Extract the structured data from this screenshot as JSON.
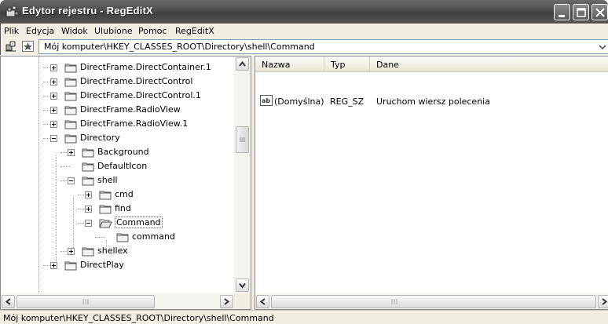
{
  "window": {
    "title": "Edytor rejestru - RegEditX"
  },
  "menu": [
    "Plik",
    "Edycja",
    "Widok",
    "Ulubione",
    "Pomoc",
    "RegEditX"
  ],
  "address": {
    "path": "Mój komputer\\HKEY_CLASSES_ROOT\\Directory\\shell\\Command"
  },
  "tree": [
    {
      "label": "DirectFrame.DirectContainer.1",
      "expander": "+"
    },
    {
      "label": "DirectFrame.DirectControl",
      "expander": "+"
    },
    {
      "label": "DirectFrame.DirectControl.1",
      "expander": "+"
    },
    {
      "label": "DirectFrame.RadioView",
      "expander": "+"
    },
    {
      "label": "DirectFrame.RadioView.1",
      "expander": "+"
    },
    {
      "label": "Directory",
      "expander": "-"
    },
    {
      "label": "Background",
      "expander": "+"
    },
    {
      "label": "DefaultIcon",
      "expander": ""
    },
    {
      "label": "shell",
      "expander": "-"
    },
    {
      "label": "cmd",
      "expander": "+"
    },
    {
      "label": "find",
      "expander": "+"
    },
    {
      "label": "Command",
      "expander": "-"
    },
    {
      "label": "command",
      "expander": ""
    },
    {
      "label": "shellex",
      "expander": "+"
    },
    {
      "label": "DirectPlay",
      "expander": "+"
    }
  ],
  "list": {
    "columns": [
      "Nazwa",
      "Typ",
      "Dane"
    ],
    "rows": [
      {
        "name": "(Domyślna)",
        "type": "REG_SZ",
        "data": "Uruchom wiersz polecenia"
      }
    ]
  },
  "status": {
    "text": "Mój komputer\\HKEY_CLASSES_ROOT\\Directory\\shell\\Command"
  }
}
